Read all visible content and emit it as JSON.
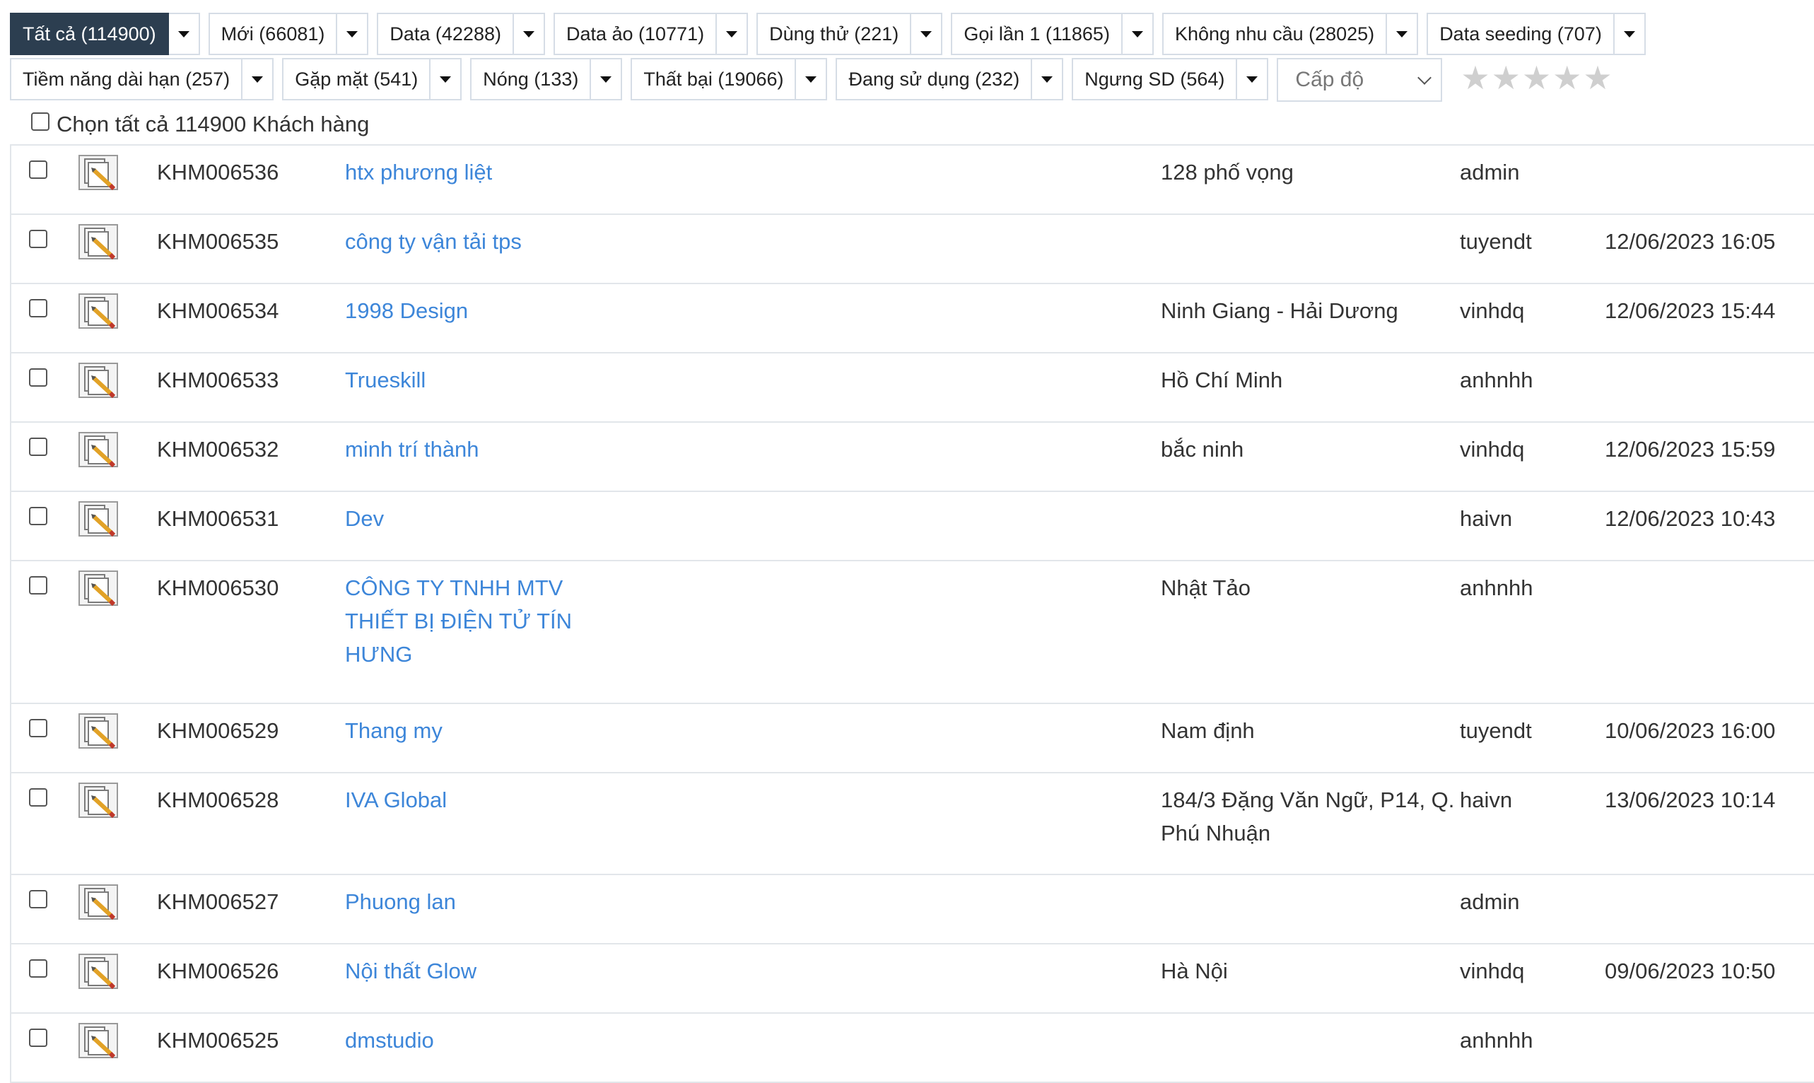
{
  "filters": {
    "row1": [
      {
        "label": "Tất cả (114900)",
        "active": true
      },
      {
        "label": "Mới (66081)"
      },
      {
        "label": "Data (42288)"
      },
      {
        "label": "Data ảo (10771)"
      },
      {
        "label": "Dùng thử (221)"
      },
      {
        "label": "Gọi lần 1 (11865)"
      },
      {
        "label": "Không nhu cầu (28025)"
      },
      {
        "label": "Data seeding (707)"
      }
    ],
    "row2": [
      {
        "label": "Tiềm năng dài hạn (257)"
      },
      {
        "label": "Gặp mặt (541)"
      },
      {
        "label": "Nóng (133)"
      },
      {
        "label": "Thất bại (19066)"
      },
      {
        "label": "Đang sử dụng (232)"
      },
      {
        "label": "Ngưng SD (564)"
      }
    ],
    "level_select": "Cấp độ",
    "stars": 5,
    "active_color": "#2c3e50"
  },
  "select_all": "Chọn tất cả 114900 Khách hàng",
  "link_color": "#3d86d9",
  "rows": [
    {
      "code": "KHM006536",
      "name": "htx phương liệt",
      "address": "128 phố vọng",
      "user": "admin",
      "date": ""
    },
    {
      "code": "KHM006535",
      "name": "công ty vận tải tps",
      "address": "",
      "user": "tuyendt",
      "date": "12/06/2023 16:05"
    },
    {
      "code": "KHM006534",
      "name": "1998 Design",
      "address": "Ninh Giang - Hải Dương",
      "user": "vinhdq",
      "date": "12/06/2023 15:44"
    },
    {
      "code": "KHM006533",
      "name": "Trueskill",
      "address": "Hồ Chí Minh",
      "user": "anhnhh",
      "date": ""
    },
    {
      "code": "KHM006532",
      "name": "minh trí thành",
      "address": "bắc ninh",
      "user": "vinhdq",
      "date": "12/06/2023 15:59"
    },
    {
      "code": "KHM006531",
      "name": "Dev",
      "address": "",
      "user": "haivn",
      "date": "12/06/2023 10:43"
    },
    {
      "code": "KHM006530",
      "name": "CÔNG TY TNHH MTV THIẾT BỊ ĐIỆN TỬ TÍN HƯNG",
      "address": "Nhật Tảo",
      "user": "anhnhh",
      "date": ""
    },
    {
      "code": "KHM006529",
      "name": "Thang my",
      "address": "Nam định",
      "user": "tuyendt",
      "date": "10/06/2023 16:00"
    },
    {
      "code": "KHM006528",
      "name": "IVA Global",
      "address": "184/3 Đặng Văn Ngữ, P14, Q. Phú Nhuận",
      "user": "haivn",
      "date": "13/06/2023 10:14"
    },
    {
      "code": "KHM006527",
      "name": "Phuong lan",
      "address": "",
      "user": "admin",
      "date": ""
    },
    {
      "code": "KHM006526",
      "name": "Nội thất Glow",
      "address": "Hà Nội",
      "user": "vinhdq",
      "date": "09/06/2023 10:50"
    },
    {
      "code": "KHM006525",
      "name": "dmstudio",
      "address": "",
      "user": "anhnhh",
      "date": ""
    }
  ]
}
